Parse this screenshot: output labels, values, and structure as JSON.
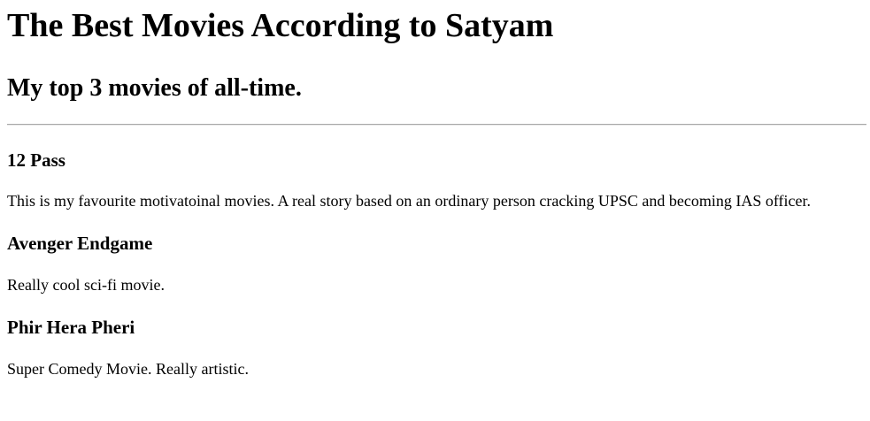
{
  "page": {
    "title": "The Best Movies According to Satyam",
    "subtitle": "My top 3 movies of all-time."
  },
  "movies": [
    {
      "title": "12 Pass",
      "description": "This is my favourite motivatoinal movies. A real story based on an ordinary person cracking UPSC and becoming IAS officer."
    },
    {
      "title": "Avenger Endgame",
      "description": "Really cool sci-fi movie."
    },
    {
      "title": "Phir Hera Pheri",
      "description": "Super Comedy Movie. Really artistic."
    }
  ]
}
